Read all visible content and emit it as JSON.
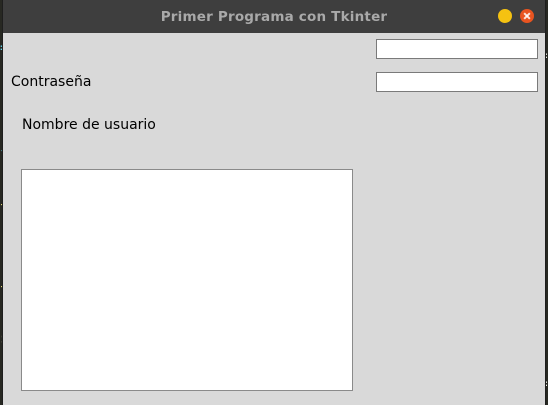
{
  "window": {
    "title": "Primer Programa con Tkinter",
    "controls": {
      "minimize_icon": "minimize-circle",
      "close_icon": "close-circle"
    }
  },
  "form": {
    "password_label": "Contraseña",
    "username_label": "Nombre de usuario",
    "username_value": "",
    "password_value": "",
    "text_area_value": ""
  },
  "colors": {
    "window_bg": "#d9d9d9",
    "titlebar_bg": "#3e3e3e",
    "title_text": "#a9a9a9",
    "minimize": "#f5c211",
    "close": "#e95420"
  }
}
